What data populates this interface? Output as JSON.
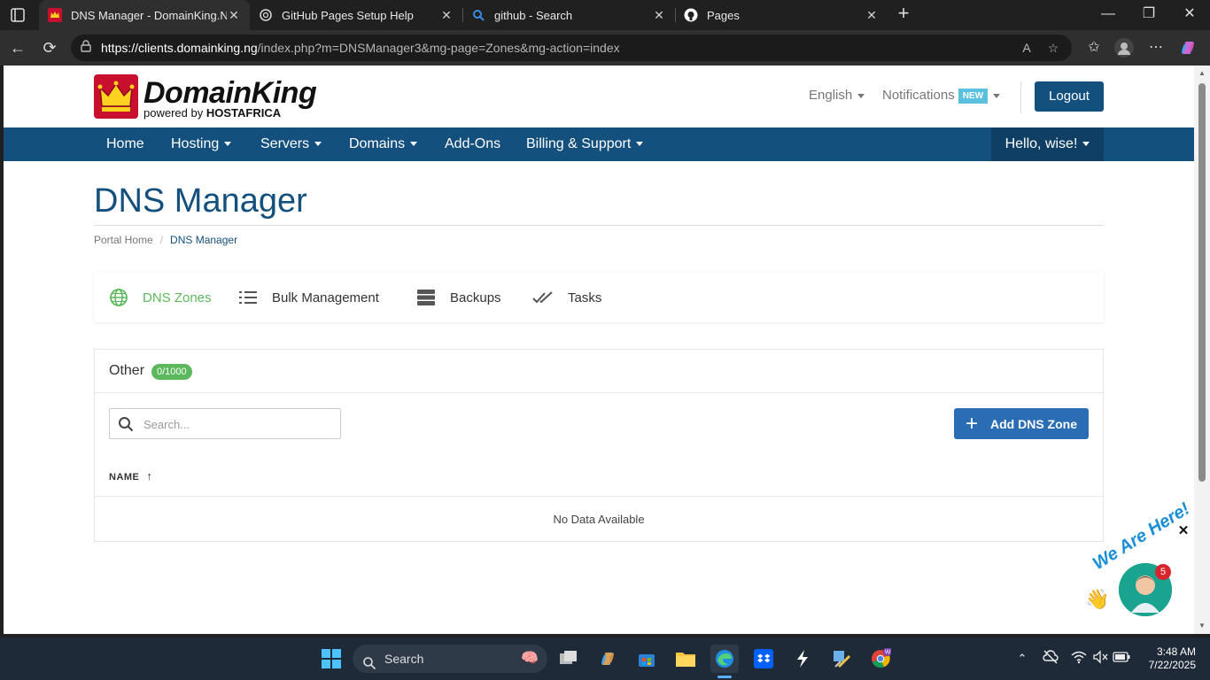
{
  "browser": {
    "tabs": [
      {
        "title": "DNS Manager - DomainKing.NG",
        "active": true
      },
      {
        "title": "GitHub Pages Setup Help",
        "active": false
      },
      {
        "title": "github - Search",
        "active": false
      },
      {
        "title": "Pages",
        "active": false
      }
    ],
    "url_host": "https://clients.domainking.ng",
    "url_path": "/index.php?m=DNSManager3&mg-page=Zones&mg-action=index"
  },
  "header": {
    "logo_name": "DomainKing",
    "logo_powered": "powered by",
    "logo_brand": "HOSTAFRICA",
    "language": "English",
    "notifications": "Notifications",
    "notifications_badge": "NEW",
    "logout": "Logout"
  },
  "nav": {
    "items": [
      {
        "label": "Home",
        "dropdown": false
      },
      {
        "label": "Hosting",
        "dropdown": true
      },
      {
        "label": "Servers",
        "dropdown": true
      },
      {
        "label": "Domains",
        "dropdown": true
      },
      {
        "label": "Add-Ons",
        "dropdown": false
      },
      {
        "label": "Billing & Support",
        "dropdown": true
      }
    ],
    "user": "Hello, wise!"
  },
  "page": {
    "title": "DNS Manager",
    "breadcrumb": [
      "Portal Home",
      "DNS Manager"
    ]
  },
  "module_tabs": [
    {
      "label": "DNS Zones",
      "icon": "globe-icon",
      "active": true
    },
    {
      "label": "Bulk Management",
      "icon": "list-icon",
      "active": false
    },
    {
      "label": "Backups",
      "icon": "server-icon",
      "active": false
    },
    {
      "label": "Tasks",
      "icon": "double-check-icon",
      "active": false
    }
  ],
  "zones": {
    "title": "Other",
    "count": "0/1000",
    "search_placeholder": "Search...",
    "add_button": "Add DNS Zone",
    "column_name": "NAME",
    "empty": "No Data Available"
  },
  "chat": {
    "text": "We Are Here!",
    "badge": "5"
  },
  "taskbar": {
    "search_label": "Search",
    "time": "3:48 AM",
    "date": "7/22/2025"
  },
  "colors": {
    "brand_blue": "#13507e",
    "active_green": "#5cb85c",
    "button_blue": "#2a6db5",
    "logo_red": "#c8102e"
  }
}
